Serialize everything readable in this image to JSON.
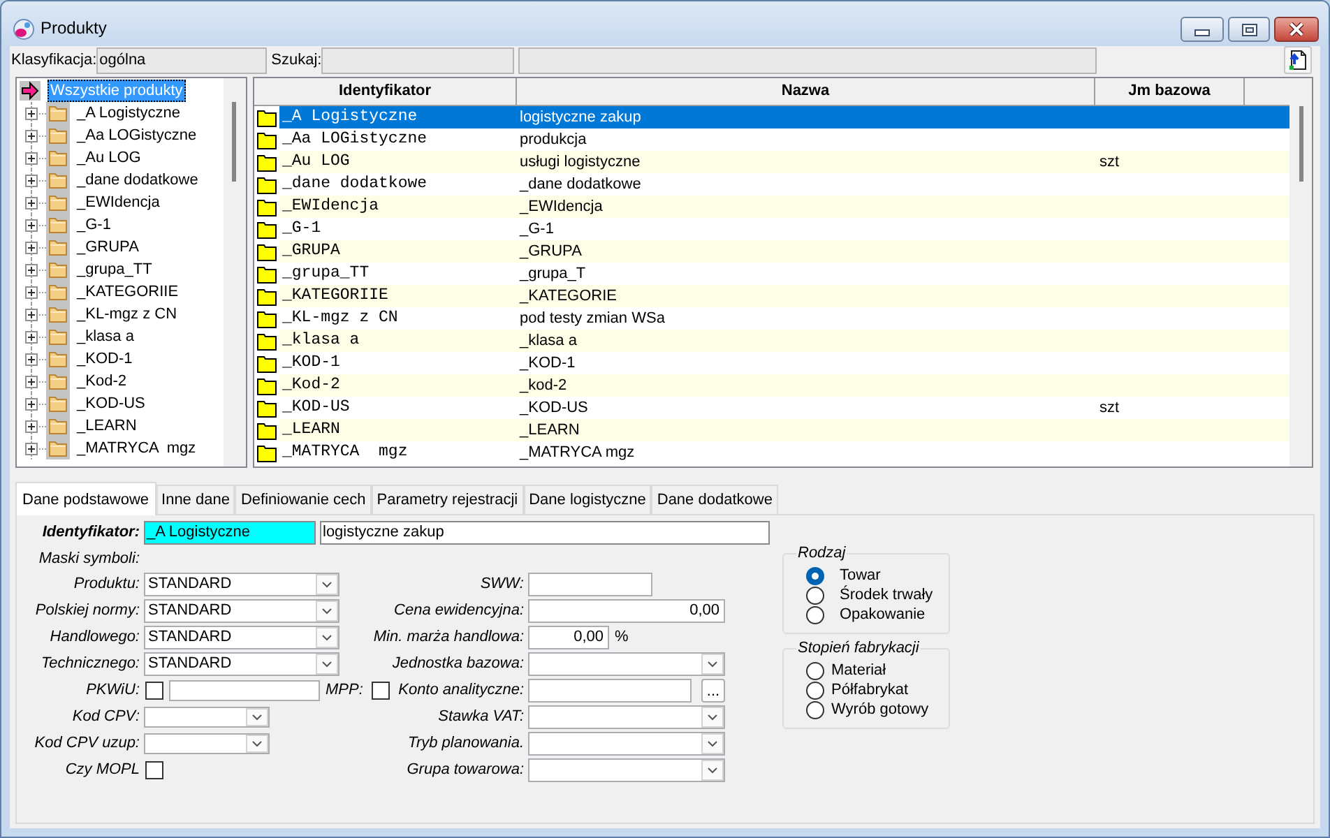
{
  "window": {
    "title": "Produkty"
  },
  "filter_bar": {
    "classification": {
      "label": "Klasyfikacja:",
      "value": "ogólna"
    },
    "search": {
      "label": "Szukaj:"
    }
  },
  "tree": {
    "label": "Wszystkie produkty",
    "selected": true,
    "children": [
      {
        "label": "_A Logistyczne",
        "expanded": false,
        "selected": false
      },
      {
        "label": "_Aa LOGistyczne",
        "expanded": false,
        "selected": false
      },
      {
        "label": "_Au LOG",
        "expanded": false,
        "selected": false
      },
      {
        "label": "_dane dodatkowe",
        "expanded": false,
        "selected": false
      },
      {
        "label": "_EWIdencja",
        "expanded": false,
        "selected": false
      },
      {
        "label": "_G-1",
        "expanded": false,
        "selected": false
      },
      {
        "label": "_GRUPA",
        "expanded": false,
        "selected": false
      },
      {
        "label": "_grupa_TT",
        "expanded": false,
        "selected": false
      },
      {
        "label": "_KATEGORIIE",
        "expanded": false,
        "selected": false
      },
      {
        "label": "_KL-mgz z CN",
        "expanded": false,
        "selected": false
      },
      {
        "label": "_klasa a",
        "expanded": false,
        "selected": false
      },
      {
        "label": "_KOD-1",
        "expanded": false,
        "selected": false
      },
      {
        "label": "_Kod-2",
        "expanded": false,
        "selected": false
      },
      {
        "label": "_KOD-US",
        "expanded": false,
        "selected": false
      },
      {
        "label": "_LEARN",
        "expanded": false,
        "selected": false
      },
      {
        "label": "_MATRYCA  mgz",
        "expanded": false,
        "selected": false
      }
    ]
  },
  "table": {
    "columns": [
      "Identyfikator",
      "Nazwa",
      "Jm bazowa"
    ],
    "rows": [
      {
        "cells": [
          "_A Logistyczne",
          "logistyczne zakup"
        ],
        "selected": true
      },
      {
        "cells": [
          "_Aa LOGistyczne",
          "produkcja"
        ],
        "selected": false
      },
      {
        "cells": [
          "_Au LOG",
          "usługi logistyczne",
          "szt"
        ],
        "selected": false
      },
      {
        "cells": [
          "_dane dodatkowe",
          "_dane dodatkowe"
        ],
        "selected": false
      },
      {
        "cells": [
          "_EWIdencja",
          "_EWIdencja"
        ],
        "selected": false
      },
      {
        "cells": [
          "_G-1",
          "_G-1"
        ],
        "selected": false
      },
      {
        "cells": [
          "_GRUPA",
          "_GRUPA"
        ],
        "selected": false
      },
      {
        "cells": [
          "_grupa_TT",
          "_grupa_T"
        ],
        "selected": false
      },
      {
        "cells": [
          "_KATEGORIIE",
          "_KATEGORIE"
        ],
        "selected": false
      },
      {
        "cells": [
          "_KL-mgz z CN",
          "pod testy zmian WSa"
        ],
        "selected": false
      },
      {
        "cells": [
          "_klasa a",
          "_klasa a"
        ],
        "selected": false
      },
      {
        "cells": [
          "_KOD-1",
          "_KOD-1"
        ],
        "selected": false
      },
      {
        "cells": [
          "_Kod-2",
          "_kod-2"
        ],
        "selected": false
      },
      {
        "cells": [
          "_KOD-US",
          "_KOD-US",
          "szt"
        ],
        "selected": false
      },
      {
        "cells": [
          "_LEARN",
          "_LEARN"
        ],
        "selected": false
      },
      {
        "cells": [
          "_MATRYCA  mgz",
          "_MATRYCA mgz"
        ],
        "selected": false
      }
    ]
  },
  "tabs": [
    {
      "label": "Dane podstawowe",
      "selected": true
    },
    {
      "label": "Inne dane",
      "selected": false
    },
    {
      "label": "Definiowanie cech",
      "selected": false
    },
    {
      "label": "Parametry rejestracji",
      "selected": false
    },
    {
      "label": "Dane logistyczne",
      "selected": false
    },
    {
      "label": "Dane dodatkowe",
      "selected": false
    }
  ],
  "form": {
    "identifier": {
      "label": "Identyfikator:",
      "code": "_A Logistyczne",
      "name": "logistyczne zakup"
    },
    "masks_heading": "Maski symboli:",
    "left": [
      {
        "kind": "combo",
        "label": "Produktu:",
        "value": "STANDARD"
      },
      {
        "kind": "combo",
        "label": "Polskiej normy:",
        "value": "STANDARD"
      },
      {
        "kind": "combo",
        "label": "Handlowego:",
        "value": "STANDARD"
      },
      {
        "kind": "combo",
        "label": "Technicznego:",
        "value": "STANDARD"
      },
      {
        "kind": "check_text",
        "label": "PKWiU:",
        "checked": false,
        "mpp": {
          "label": "MPP:",
          "checked": false
        }
      },
      {
        "kind": "short_combo",
        "label": "Kod CPV:"
      },
      {
        "kind": "short_combo",
        "label": "Kod CPV uzup:"
      },
      {
        "kind": "check",
        "label": "Czy MOPL",
        "checked": false
      }
    ],
    "right": [
      {
        "kind": "text",
        "label": "SWW:"
      },
      {
        "kind": "number",
        "label": "Cena ewidencyjna:",
        "value": "0,00"
      },
      {
        "kind": "percent",
        "label": "Min. marża handlowa:",
        "value": "0,00",
        "unit": "%"
      },
      {
        "kind": "combo",
        "label": "Jednostka bazowa:"
      },
      {
        "kind": "lookup",
        "label": "Konto analityczne:",
        "button": "..."
      },
      {
        "kind": "combo",
        "label": "Stawka VAT:"
      },
      {
        "kind": "combo",
        "label": "Tryb planowania."
      },
      {
        "kind": "combo",
        "label": "Grupa towarowa:"
      }
    ],
    "groups": [
      {
        "title": "Rodzaj",
        "options": [
          {
            "label": "Towar",
            "selected": true
          },
          {
            "label": "Środek trwały",
            "selected": false
          },
          {
            "label": "Opakowanie",
            "selected": false
          }
        ]
      },
      {
        "title": "Stopień fabrykacji",
        "options": [
          {
            "label": "Materiał",
            "selected": false
          },
          {
            "label": "Półfabrykat",
            "selected": false
          },
          {
            "label": "Wyrób gotowy",
            "selected": false
          }
        ]
      }
    ]
  }
}
